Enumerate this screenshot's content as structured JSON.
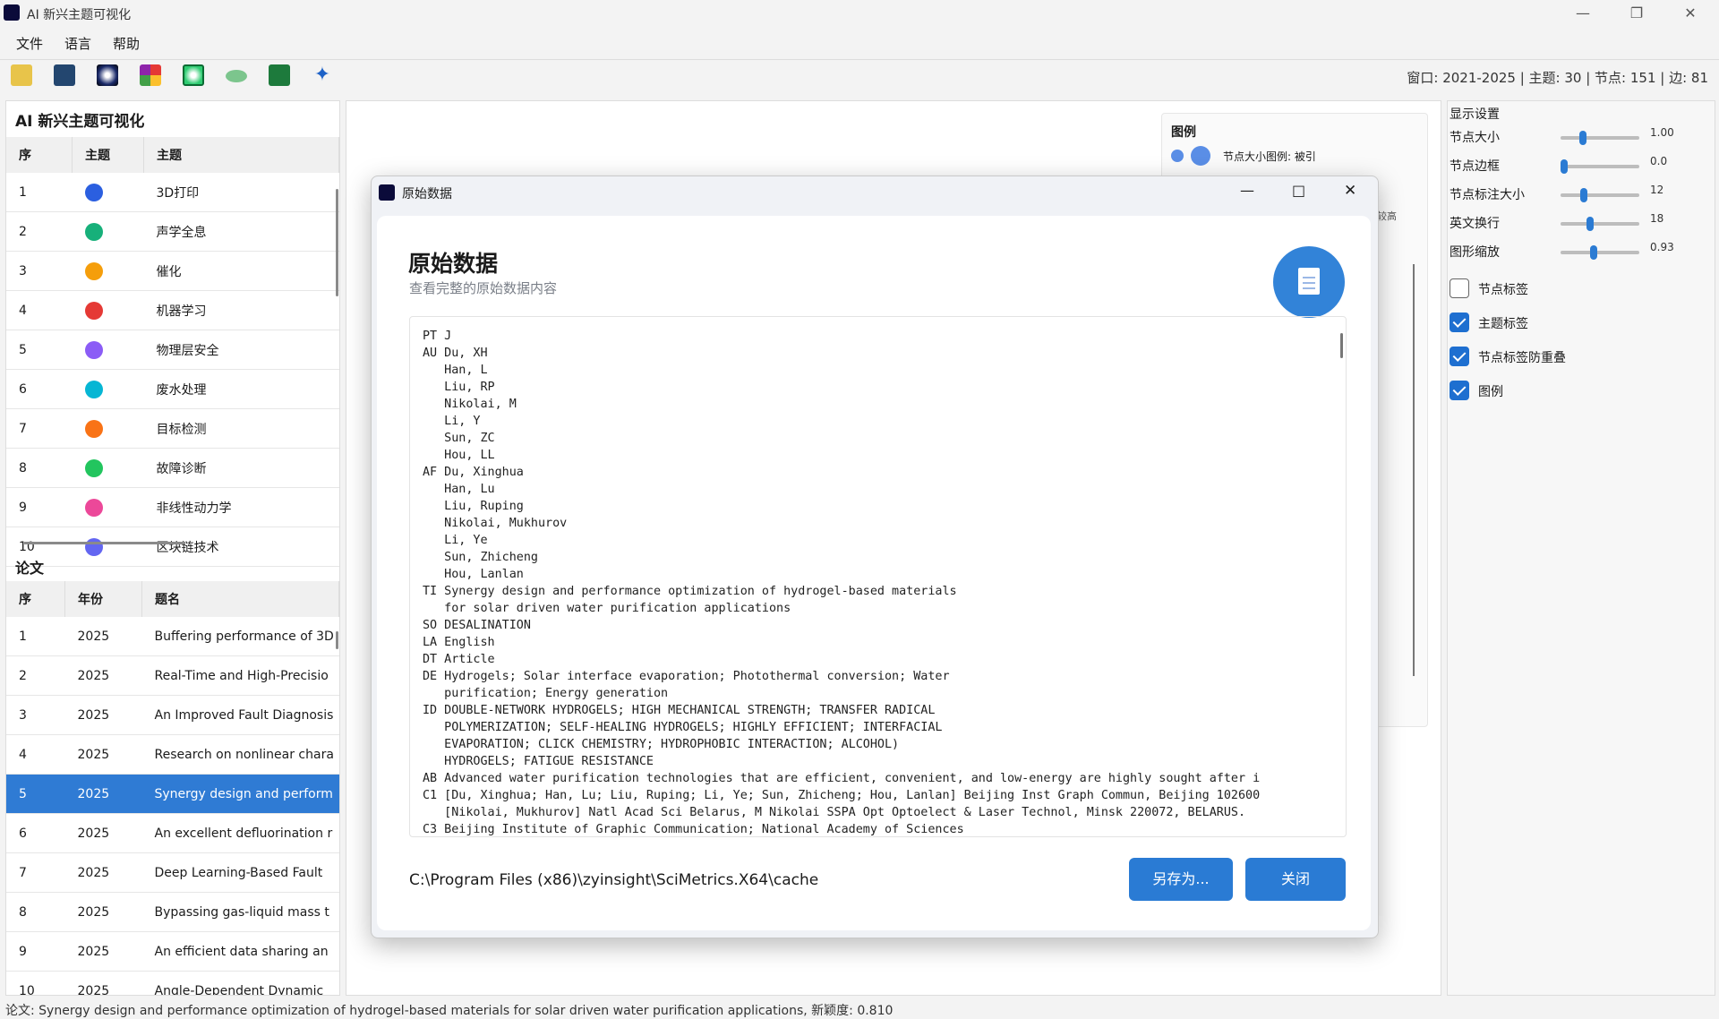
{
  "window": {
    "title": "AI 新兴主题可视化"
  },
  "menu": [
    "文件",
    "语言",
    "帮助"
  ],
  "stats": "窗口: 2021-2025 | 主题: 30 | 节点: 151 | 边: 81",
  "left": {
    "title": "AI 新兴主题可视化",
    "topics_headers": [
      "序",
      "主题",
      "主题"
    ],
    "topics": [
      {
        "n": "1",
        "name": "3D打印",
        "color": "#2b5fe0"
      },
      {
        "n": "2",
        "name": "声学全息",
        "color": "#17b07a"
      },
      {
        "n": "3",
        "name": "催化",
        "color": "#f59e0b"
      },
      {
        "n": "4",
        "name": "机器学习",
        "color": "#e53935"
      },
      {
        "n": "5",
        "name": "物理层安全",
        "color": "#8b5cf6"
      },
      {
        "n": "6",
        "name": "废水处理",
        "color": "#06b6d4"
      },
      {
        "n": "7",
        "name": "目标检测",
        "color": "#f97316"
      },
      {
        "n": "8",
        "name": "故障诊断",
        "color": "#22c55e"
      },
      {
        "n": "9",
        "name": "非线性动力学",
        "color": "#ec4899"
      },
      {
        "n": "10",
        "name": "区块链技术",
        "color": "#6366f1"
      }
    ],
    "papers_title": "论文",
    "papers_headers": [
      "序",
      "年份",
      "题名"
    ],
    "papers": [
      {
        "n": "1",
        "year": "2025",
        "title": "Buffering performance of 3D"
      },
      {
        "n": "2",
        "year": "2025",
        "title": "Real-Time and High-Precisio"
      },
      {
        "n": "3",
        "year": "2025",
        "title": "An Improved Fault Diagnosis"
      },
      {
        "n": "4",
        "year": "2025",
        "title": "Research on nonlinear chara"
      },
      {
        "n": "5",
        "year": "2025",
        "title": "Synergy design and perform"
      },
      {
        "n": "6",
        "year": "2025",
        "title": "An excellent defluorination r"
      },
      {
        "n": "7",
        "year": "2025",
        "title": "Deep Learning-Based Fault"
      },
      {
        "n": "8",
        "year": "2025",
        "title": "Bypassing gas-liquid mass t"
      },
      {
        "n": "9",
        "year": "2025",
        "title": "An efficient data sharing an"
      },
      {
        "n": "10",
        "year": "2025",
        "title": "Angle-Dependent Dynamic"
      }
    ]
  },
  "legend": {
    "title": "图例",
    "size_text": "节点大小图例: 被引",
    "high": "较高"
  },
  "settings": {
    "title": "显示设置",
    "sliders": [
      {
        "label": "节点大小",
        "value": "1.00",
        "pos": 0.28
      },
      {
        "label": "节点边框",
        "value": "0.0",
        "pos": 0.05
      },
      {
        "label": "节点标注大小",
        "value": "12",
        "pos": 0.3
      },
      {
        "label": "英文换行",
        "value": "18",
        "pos": 0.38
      },
      {
        "label": "图形缩放",
        "value": "0.93",
        "pos": 0.42
      }
    ],
    "checks": [
      {
        "label": "节点标签",
        "on": false
      },
      {
        "label": "主题标签",
        "on": true
      },
      {
        "label": "节点标签防重叠",
        "on": true
      },
      {
        "label": "图例",
        "on": true
      }
    ]
  },
  "status": "论文: Synergy design and performance optimization of hydrogel-based materials for solar driven water purification applications, 新颖度: 0.810",
  "dialog": {
    "window_title": "原始数据",
    "title": "原始数据",
    "subtitle": "查看完整的原始数据内容",
    "raw": "PT J\nAU Du, XH\n   Han, L\n   Liu, RP\n   Nikolai, M\n   Li, Y\n   Sun, ZC\n   Hou, LL\nAF Du, Xinghua\n   Han, Lu\n   Liu, Ruping\n   Nikolai, Mukhurov\n   Li, Ye\n   Sun, Zhicheng\n   Hou, Lanlan\nTI Synergy design and performance optimization of hydrogel-based materials\n   for solar driven water purification applications\nSO DESALINATION\nLA English\nDT Article\nDE Hydrogels; Solar interface evaporation; Photothermal conversion; Water\n   purification; Energy generation\nID DOUBLE-NETWORK HYDROGELS; HIGH MECHANICAL STRENGTH; TRANSFER RADICAL\n   POLYMERIZATION; SELF-HEALING HYDROGELS; HIGHLY EFFICIENT; INTERFACIAL\n   EVAPORATION; CLICK CHEMISTRY; HYDROPHOBIC INTERACTION; ALCOHOL)\n   HYDROGELS; FATIGUE RESISTANCE\nAB Advanced water purification technologies that are efficient, convenient, and low-energy are highly sought after i\nC1 [Du, Xinghua; Han, Lu; Liu, Ruping; Li, Ye; Sun, Zhicheng; Hou, Lanlan] Beijing Inst Graph Commun, Beijing 102600\n   [Nikolai, Mukhurov] Natl Acad Sci Belarus, M Nikolai SSPA Opt Optoelect & Laser Technol, Minsk 220072, BELARUS.\nC3 Beijing Institute of Graphic Communication; National Academy of Sciences",
    "path": "C:\\Program Files (x86)\\zyinsight\\SciMetrics.X64\\cache",
    "save_label": "另存为...",
    "close_label": "关闭"
  }
}
